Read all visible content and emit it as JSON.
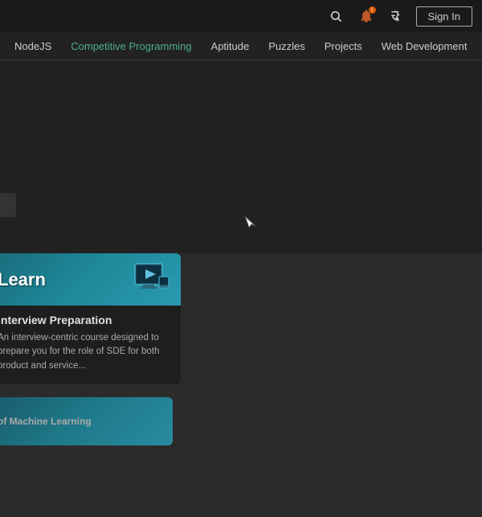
{
  "topbar": {
    "search_placeholder": "Search",
    "signin_label": "Sign In"
  },
  "navbar": {
    "items": [
      {
        "id": "nodejs",
        "label": "NodeJS"
      },
      {
        "id": "competitive-programming",
        "label": "Competitive Programming"
      },
      {
        "id": "aptitude",
        "label": "Aptitude"
      },
      {
        "id": "puzzles",
        "label": "Puzzles"
      },
      {
        "id": "projects",
        "label": "Projects"
      },
      {
        "id": "web-development",
        "label": "Web Development"
      }
    ]
  },
  "cards": [
    {
      "id": "interview-prep",
      "banner_label": "Learn",
      "title": "Interview Preparation",
      "description": "An interview-centric course designed to prepare you for the role of SDE for both product and service..."
    },
    {
      "id": "machine-learning",
      "banner_label": "",
      "title": "of Machine Learning",
      "description": ""
    }
  ],
  "icons": {
    "search": "🔍",
    "notification": "🔔",
    "translate": "🌐"
  }
}
